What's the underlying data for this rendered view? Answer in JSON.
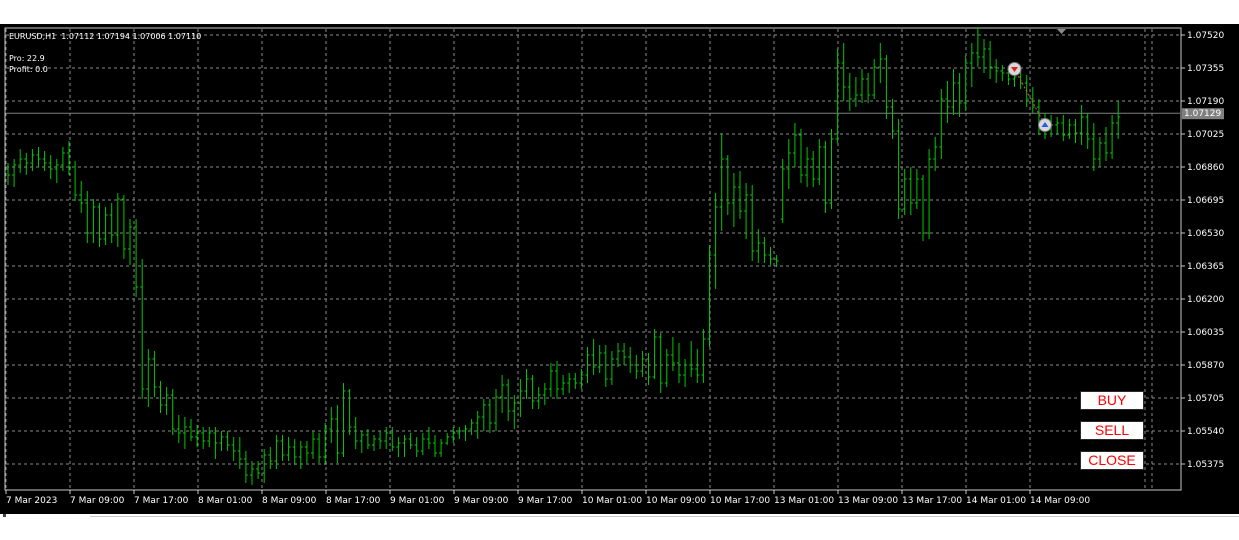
{
  "chart": {
    "symbol_line": "EURUSD,H1  1.07112 1.07194 1.07006 1.07110",
    "pro_label": "Pro: 22.9",
    "profit_label": "Profit: 0.0",
    "current_price": "1.07129",
    "price_ticks": [
      "1.07520",
      "1.07355",
      "1.07190",
      "1.07025",
      "1.06860",
      "1.06695",
      "1.06530",
      "1.06365",
      "1.06200",
      "1.06035",
      "1.05870",
      "1.05705",
      "1.05540",
      "1.05375"
    ],
    "time_ticks": [
      "7 Mar 2023",
      "7 Mar 09:00",
      "7 Mar 17:00",
      "8 Mar 01:00",
      "8 Mar 09:00",
      "8 Mar 17:00",
      "9 Mar 01:00",
      "9 Mar 09:00",
      "9 Mar 17:00",
      "10 Mar 01:00",
      "10 Mar 09:00",
      "10 Mar 17:00",
      "13 Mar 01:00",
      "13 Mar 09:00",
      "13 Mar 17:00",
      "14 Mar 01:00",
      "14 Mar 09:00"
    ],
    "colors": {
      "background": "#000000",
      "bars": "#00c800",
      "grid": "#8a8a8a",
      "text": "#ffffff",
      "price_label_bg": "#808080",
      "button_text": "#ff0000"
    },
    "icons": {
      "sell_marker": "sell-arrow-down-icon",
      "buy_marker": "buy-arrow-up-icon",
      "shift_marker": "chart-shift-triangle-icon"
    }
  },
  "buttons": {
    "buy": "BUY",
    "sell": "SELL",
    "close": "CLOSE"
  },
  "chart_data": {
    "type": "ohlc",
    "symbol": "EURUSD",
    "timeframe": "H1",
    "ylim": [
      1.053,
      1.076
    ],
    "grid": true,
    "bars": [
      {
        "o": 1.0685,
        "h": 1.0688,
        "l": 1.0677,
        "c": 1.0682
      },
      {
        "o": 1.0682,
        "h": 1.069,
        "l": 1.0676,
        "c": 1.0687
      },
      {
        "o": 1.0687,
        "h": 1.0695,
        "l": 1.0683,
        "c": 1.069
      },
      {
        "o": 1.069,
        "h": 1.0693,
        "l": 1.0682,
        "c": 1.0688
      },
      {
        "o": 1.0688,
        "h": 1.0695,
        "l": 1.0684,
        "c": 1.0692
      },
      {
        "o": 1.0692,
        "h": 1.0696,
        "l": 1.0686,
        "c": 1.069
      },
      {
        "o": 1.069,
        "h": 1.0694,
        "l": 1.0684,
        "c": 1.0688
      },
      {
        "o": 1.0688,
        "h": 1.0692,
        "l": 1.068,
        "c": 1.0685
      },
      {
        "o": 1.0685,
        "h": 1.069,
        "l": 1.0678,
        "c": 1.0687
      },
      {
        "o": 1.0687,
        "h": 1.0696,
        "l": 1.0684,
        "c": 1.0693
      },
      {
        "o": 1.0693,
        "h": 1.0699,
        "l": 1.0682,
        "c": 1.0686
      },
      {
        "o": 1.0686,
        "h": 1.0689,
        "l": 1.0669,
        "c": 1.0672
      },
      {
        "o": 1.0672,
        "h": 1.0679,
        "l": 1.0663,
        "c": 1.0668
      },
      {
        "o": 1.0668,
        "h": 1.0674,
        "l": 1.0648,
        "c": 1.0653
      },
      {
        "o": 1.0653,
        "h": 1.067,
        "l": 1.0648,
        "c": 1.0666
      },
      {
        "o": 1.0666,
        "h": 1.0668,
        "l": 1.0646,
        "c": 1.065
      },
      {
        "o": 1.065,
        "h": 1.0666,
        "l": 1.0647,
        "c": 1.0662
      },
      {
        "o": 1.0662,
        "h": 1.0668,
        "l": 1.0648,
        "c": 1.0652
      },
      {
        "o": 1.0652,
        "h": 1.0673,
        "l": 1.0646,
        "c": 1.067
      },
      {
        "o": 1.067,
        "h": 1.0672,
        "l": 1.064,
        "c": 1.0645
      },
      {
        "o": 1.0645,
        "h": 1.066,
        "l": 1.0637,
        "c": 1.0656
      },
      {
        "o": 1.0656,
        "h": 1.066,
        "l": 1.0621,
        "c": 1.0626
      },
      {
        "o": 1.0626,
        "h": 1.064,
        "l": 1.057,
        "c": 1.0575
      },
      {
        "o": 1.0575,
        "h": 1.0595,
        "l": 1.0566,
        "c": 1.059
      },
      {
        "o": 1.059,
        "h": 1.0594,
        "l": 1.0571,
        "c": 1.0576
      },
      {
        "o": 1.0576,
        "h": 1.0579,
        "l": 1.0563,
        "c": 1.0567
      },
      {
        "o": 1.0567,
        "h": 1.0576,
        "l": 1.0562,
        "c": 1.0572
      },
      {
        "o": 1.0572,
        "h": 1.0575,
        "l": 1.0552,
        "c": 1.0555
      },
      {
        "o": 1.0555,
        "h": 1.0562,
        "l": 1.0548,
        "c": 1.0553
      },
      {
        "o": 1.0553,
        "h": 1.0561,
        "l": 1.0545,
        "c": 1.0556
      },
      {
        "o": 1.0556,
        "h": 1.056,
        "l": 1.0549,
        "c": 1.0551
      },
      {
        "o": 1.0551,
        "h": 1.0557,
        "l": 1.0546,
        "c": 1.0553
      },
      {
        "o": 1.0553,
        "h": 1.0556,
        "l": 1.0545,
        "c": 1.0549
      },
      {
        "o": 1.0549,
        "h": 1.0556,
        "l": 1.0546,
        "c": 1.0553
      },
      {
        "o": 1.0553,
        "h": 1.0556,
        "l": 1.054,
        "c": 1.0548
      },
      {
        "o": 1.0548,
        "h": 1.0554,
        "l": 1.0544,
        "c": 1.0551
      },
      {
        "o": 1.0551,
        "h": 1.0554,
        "l": 1.0544,
        "c": 1.0547
      },
      {
        "o": 1.0547,
        "h": 1.0551,
        "l": 1.0539,
        "c": 1.0544
      },
      {
        "o": 1.0544,
        "h": 1.0551,
        "l": 1.0535,
        "c": 1.054
      },
      {
        "o": 1.054,
        "h": 1.0544,
        "l": 1.0528,
        "c": 1.0532
      },
      {
        "o": 1.0532,
        "h": 1.0539,
        "l": 1.0527,
        "c": 1.0535
      },
      {
        "o": 1.0535,
        "h": 1.0539,
        "l": 1.053,
        "c": 1.0533
      },
      {
        "o": 1.0533,
        "h": 1.0545,
        "l": 1.0528,
        "c": 1.0542
      },
      {
        "o": 1.0542,
        "h": 1.0546,
        "l": 1.0535,
        "c": 1.0539
      },
      {
        "o": 1.0539,
        "h": 1.0552,
        "l": 1.0535,
        "c": 1.0549
      },
      {
        "o": 1.0549,
        "h": 1.0552,
        "l": 1.0539,
        "c": 1.0542
      },
      {
        "o": 1.0542,
        "h": 1.0551,
        "l": 1.0539,
        "c": 1.0546
      },
      {
        "o": 1.0546,
        "h": 1.055,
        "l": 1.0537,
        "c": 1.0541
      },
      {
        "o": 1.0541,
        "h": 1.0549,
        "l": 1.0535,
        "c": 1.0546
      },
      {
        "o": 1.0546,
        "h": 1.0549,
        "l": 1.0538,
        "c": 1.0543
      },
      {
        "o": 1.0543,
        "h": 1.0554,
        "l": 1.054,
        "c": 1.055
      },
      {
        "o": 1.055,
        "h": 1.0553,
        "l": 1.0538,
        "c": 1.0541
      },
      {
        "o": 1.0541,
        "h": 1.0558,
        "l": 1.0537,
        "c": 1.0555
      },
      {
        "o": 1.0555,
        "h": 1.0566,
        "l": 1.0548,
        "c": 1.056
      },
      {
        "o": 1.056,
        "h": 1.0567,
        "l": 1.0538,
        "c": 1.0543
      },
      {
        "o": 1.0543,
        "h": 1.0578,
        "l": 1.0541,
        "c": 1.0574
      },
      {
        "o": 1.0574,
        "h": 1.0575,
        "l": 1.0552,
        "c": 1.0556
      },
      {
        "o": 1.0556,
        "h": 1.0561,
        "l": 1.0545,
        "c": 1.0549
      },
      {
        "o": 1.0549,
        "h": 1.0554,
        "l": 1.0543,
        "c": 1.0552
      },
      {
        "o": 1.0552,
        "h": 1.0555,
        "l": 1.0545,
        "c": 1.0547
      },
      {
        "o": 1.0547,
        "h": 1.0552,
        "l": 1.0544,
        "c": 1.055
      },
      {
        "o": 1.055,
        "h": 1.0554,
        "l": 1.0545,
        "c": 1.0549
      },
      {
        "o": 1.0549,
        "h": 1.0556,
        "l": 1.0545,
        "c": 1.0553
      },
      {
        "o": 1.0553,
        "h": 1.0556,
        "l": 1.0544,
        "c": 1.0546
      },
      {
        "o": 1.0546,
        "h": 1.0551,
        "l": 1.0541,
        "c": 1.0548
      },
      {
        "o": 1.0548,
        "h": 1.0552,
        "l": 1.0541,
        "c": 1.055
      },
      {
        "o": 1.055,
        "h": 1.0553,
        "l": 1.0545,
        "c": 1.0547
      },
      {
        "o": 1.0547,
        "h": 1.0551,
        "l": 1.0541,
        "c": 1.0544
      },
      {
        "o": 1.0544,
        "h": 1.0553,
        "l": 1.0542,
        "c": 1.055
      },
      {
        "o": 1.055,
        "h": 1.0556,
        "l": 1.0545,
        "c": 1.0548
      },
      {
        "o": 1.0548,
        "h": 1.0552,
        "l": 1.0541,
        "c": 1.0543
      },
      {
        "o": 1.0543,
        "h": 1.055,
        "l": 1.0541,
        "c": 1.0548
      },
      {
        "o": 1.0548,
        "h": 1.0553,
        "l": 1.0547,
        "c": 1.0551
      },
      {
        "o": 1.0551,
        "h": 1.0556,
        "l": 1.0548,
        "c": 1.0553
      },
      {
        "o": 1.0553,
        "h": 1.0556,
        "l": 1.055,
        "c": 1.0554
      },
      {
        "o": 1.0554,
        "h": 1.0557,
        "l": 1.0549,
        "c": 1.0555
      },
      {
        "o": 1.0555,
        "h": 1.056,
        "l": 1.0552,
        "c": 1.0558
      },
      {
        "o": 1.0558,
        "h": 1.0564,
        "l": 1.055,
        "c": 1.0561
      },
      {
        "o": 1.0561,
        "h": 1.057,
        "l": 1.0554,
        "c": 1.0567
      },
      {
        "o": 1.0567,
        "h": 1.057,
        "l": 1.0553,
        "c": 1.0558
      },
      {
        "o": 1.0558,
        "h": 1.0575,
        "l": 1.0554,
        "c": 1.0571
      },
      {
        "o": 1.0571,
        "h": 1.0582,
        "l": 1.0563,
        "c": 1.0577
      },
      {
        "o": 1.0577,
        "h": 1.058,
        "l": 1.0559,
        "c": 1.0564
      },
      {
        "o": 1.0564,
        "h": 1.0572,
        "l": 1.0555,
        "c": 1.0568
      },
      {
        "o": 1.0568,
        "h": 1.058,
        "l": 1.0561,
        "c": 1.0574
      },
      {
        "o": 1.0574,
        "h": 1.0585,
        "l": 1.057,
        "c": 1.058
      },
      {
        "o": 1.058,
        "h": 1.0582,
        "l": 1.0565,
        "c": 1.0569
      },
      {
        "o": 1.0569,
        "h": 1.0576,
        "l": 1.0565,
        "c": 1.0572
      },
      {
        "o": 1.0572,
        "h": 1.0578,
        "l": 1.0567,
        "c": 1.0575
      },
      {
        "o": 1.0575,
        "h": 1.0588,
        "l": 1.0571,
        "c": 1.0584
      },
      {
        "o": 1.0584,
        "h": 1.0589,
        "l": 1.057,
        "c": 1.0575
      },
      {
        "o": 1.0575,
        "h": 1.0582,
        "l": 1.0572,
        "c": 1.0578
      },
      {
        "o": 1.0578,
        "h": 1.0583,
        "l": 1.0573,
        "c": 1.058
      },
      {
        "o": 1.058,
        "h": 1.0583,
        "l": 1.0575,
        "c": 1.0578
      },
      {
        "o": 1.0578,
        "h": 1.0585,
        "l": 1.0575,
        "c": 1.0582
      },
      {
        "o": 1.0582,
        "h": 1.0596,
        "l": 1.0578,
        "c": 1.0592
      },
      {
        "o": 1.0592,
        "h": 1.06,
        "l": 1.0582,
        "c": 1.0586
      },
      {
        "o": 1.0586,
        "h": 1.0597,
        "l": 1.0583,
        "c": 1.0593
      },
      {
        "o": 1.0593,
        "h": 1.0597,
        "l": 1.0576,
        "c": 1.058
      },
      {
        "o": 1.058,
        "h": 1.0594,
        "l": 1.0577,
        "c": 1.059
      },
      {
        "o": 1.059,
        "h": 1.0598,
        "l": 1.0586,
        "c": 1.0594
      },
      {
        "o": 1.0594,
        "h": 1.0598,
        "l": 1.0587,
        "c": 1.0591
      },
      {
        "o": 1.0591,
        "h": 1.0596,
        "l": 1.0583,
        "c": 1.0587
      },
      {
        "o": 1.0587,
        "h": 1.0592,
        "l": 1.058,
        "c": 1.0584
      },
      {
        "o": 1.0584,
        "h": 1.0594,
        "l": 1.0581,
        "c": 1.059
      },
      {
        "o": 1.059,
        "h": 1.0593,
        "l": 1.0577,
        "c": 1.0581
      },
      {
        "o": 1.0581,
        "h": 1.0605,
        "l": 1.058,
        "c": 1.0601
      },
      {
        "o": 1.0601,
        "h": 1.0603,
        "l": 1.0573,
        "c": 1.0578
      },
      {
        "o": 1.0578,
        "h": 1.0595,
        "l": 1.0576,
        "c": 1.0592
      },
      {
        "o": 1.0592,
        "h": 1.0601,
        "l": 1.0584,
        "c": 1.0588
      },
      {
        "o": 1.0588,
        "h": 1.0598,
        "l": 1.0578,
        "c": 1.0582
      },
      {
        "o": 1.0582,
        "h": 1.059,
        "l": 1.0576,
        "c": 1.0587
      },
      {
        "o": 1.0587,
        "h": 1.0599,
        "l": 1.0581,
        "c": 1.0585
      },
      {
        "o": 1.0585,
        "h": 1.0595,
        "l": 1.0578,
        "c": 1.0582
      },
      {
        "o": 1.0582,
        "h": 1.0605,
        "l": 1.0578,
        "c": 1.06
      },
      {
        "o": 1.06,
        "h": 1.0647,
        "l": 1.0596,
        "c": 1.0642
      },
      {
        "o": 1.0642,
        "h": 1.0673,
        "l": 1.0625,
        "c": 1.0666
      },
      {
        "o": 1.0666,
        "h": 1.0703,
        "l": 1.0654,
        "c": 1.069
      },
      {
        "o": 1.069,
        "h": 1.0692,
        "l": 1.0662,
        "c": 1.0668
      },
      {
        "o": 1.0668,
        "h": 1.0683,
        "l": 1.0656,
        "c": 1.0676
      },
      {
        "o": 1.0676,
        "h": 1.0684,
        "l": 1.066,
        "c": 1.0664
      },
      {
        "o": 1.0664,
        "h": 1.0678,
        "l": 1.065,
        "c": 1.0672
      },
      {
        "o": 1.0672,
        "h": 1.0677,
        "l": 1.0639,
        "c": 1.0644
      },
      {
        "o": 1.0644,
        "h": 1.0655,
        "l": 1.0638,
        "c": 1.0648
      },
      {
        "o": 1.0648,
        "h": 1.0651,
        "l": 1.0638,
        "c": 1.0642
      },
      {
        "o": 1.0642,
        "h": 1.0646,
        "l": 1.0637,
        "c": 1.064
      },
      {
        "o": 1.064,
        "h": 1.0642,
        "l": 1.0636,
        "c": 1.0639
      },
      {
        "o": 1.066,
        "h": 1.069,
        "l": 1.0658,
        "c": 1.0685
      },
      {
        "o": 1.0685,
        "h": 1.07,
        "l": 1.0675,
        "c": 1.0693
      },
      {
        "o": 1.0693,
        "h": 1.0708,
        "l": 1.0686,
        "c": 1.0702
      },
      {
        "o": 1.0702,
        "h": 1.0705,
        "l": 1.0678,
        "c": 1.0682
      },
      {
        "o": 1.0682,
        "h": 1.0696,
        "l": 1.0676,
        "c": 1.069
      },
      {
        "o": 1.069,
        "h": 1.0694,
        "l": 1.0676,
        "c": 1.068
      },
      {
        "o": 1.068,
        "h": 1.07,
        "l": 1.0677,
        "c": 1.0696
      },
      {
        "o": 1.0696,
        "h": 1.0699,
        "l": 1.0663,
        "c": 1.0668
      },
      {
        "o": 1.0668,
        "h": 1.0705,
        "l": 1.0665,
        "c": 1.07
      },
      {
        "o": 1.07,
        "h": 1.0745,
        "l": 1.0698,
        "c": 1.0738
      },
      {
        "o": 1.0738,
        "h": 1.0748,
        "l": 1.0719,
        "c": 1.0726
      },
      {
        "o": 1.0726,
        "h": 1.0733,
        "l": 1.0714,
        "c": 1.072
      },
      {
        "o": 1.072,
        "h": 1.0731,
        "l": 1.0716,
        "c": 1.0722
      },
      {
        "o": 1.0722,
        "h": 1.0735,
        "l": 1.0718,
        "c": 1.073
      },
      {
        "o": 1.073,
        "h": 1.0733,
        "l": 1.0718,
        "c": 1.0722
      },
      {
        "o": 1.0722,
        "h": 1.074,
        "l": 1.072,
        "c": 1.0736
      },
      {
        "o": 1.0736,
        "h": 1.0748,
        "l": 1.0728,
        "c": 1.074
      },
      {
        "o": 1.074,
        "h": 1.0742,
        "l": 1.071,
        "c": 1.0716
      },
      {
        "o": 1.0716,
        "h": 1.072,
        "l": 1.07,
        "c": 1.0704
      },
      {
        "o": 1.0704,
        "h": 1.071,
        "l": 1.066,
        "c": 1.0665
      },
      {
        "o": 1.0665,
        "h": 1.0685,
        "l": 1.0662,
        "c": 1.068
      },
      {
        "o": 1.068,
        "h": 1.0686,
        "l": 1.0662,
        "c": 1.0668
      },
      {
        "o": 1.0668,
        "h": 1.0685,
        "l": 1.0665,
        "c": 1.068
      },
      {
        "o": 1.068,
        "h": 1.0682,
        "l": 1.0649,
        "c": 1.0653
      },
      {
        "o": 1.0653,
        "h": 1.0695,
        "l": 1.065,
        "c": 1.069
      },
      {
        "o": 1.069,
        "h": 1.0701,
        "l": 1.0684,
        "c": 1.0696
      },
      {
        "o": 1.0696,
        "h": 1.0725,
        "l": 1.069,
        "c": 1.072
      },
      {
        "o": 1.072,
        "h": 1.0729,
        "l": 1.0708,
        "c": 1.0716
      },
      {
        "o": 1.0716,
        "h": 1.0735,
        "l": 1.0712,
        "c": 1.0728
      },
      {
        "o": 1.0728,
        "h": 1.0733,
        "l": 1.0711,
        "c": 1.0718
      },
      {
        "o": 1.0718,
        "h": 1.0742,
        "l": 1.0714,
        "c": 1.0738
      },
      {
        "o": 1.0738,
        "h": 1.0748,
        "l": 1.0726,
        "c": 1.0743
      },
      {
        "o": 1.0743,
        "h": 1.0756,
        "l": 1.0736,
        "c": 1.0741
      },
      {
        "o": 1.0741,
        "h": 1.075,
        "l": 1.0733,
        "c": 1.0745
      },
      {
        "o": 1.0745,
        "h": 1.0749,
        "l": 1.073,
        "c": 1.0736
      },
      {
        "o": 1.0736,
        "h": 1.074,
        "l": 1.0728,
        "c": 1.0734
      },
      {
        "o": 1.0734,
        "h": 1.0737,
        "l": 1.0729,
        "c": 1.0733
      },
      {
        "o": 1.0733,
        "h": 1.0736,
        "l": 1.0727,
        "c": 1.073
      },
      {
        "o": 1.073,
        "h": 1.0734,
        "l": 1.0726,
        "c": 1.0731
      },
      {
        "o": 1.0731,
        "h": 1.0735,
        "l": 1.0725,
        "c": 1.0728
      },
      {
        "o": 1.0728,
        "h": 1.0732,
        "l": 1.0716,
        "c": 1.072
      },
      {
        "o": 1.072,
        "h": 1.0726,
        "l": 1.0713,
        "c": 1.0716
      },
      {
        "o": 1.0716,
        "h": 1.072,
        "l": 1.0702,
        "c": 1.0705
      },
      {
        "o": 1.0705,
        "h": 1.0713,
        "l": 1.07,
        "c": 1.0709
      },
      {
        "o": 1.0709,
        "h": 1.0712,
        "l": 1.0701,
        "c": 1.0707
      },
      {
        "o": 1.0707,
        "h": 1.0711,
        "l": 1.0702,
        "c": 1.0708
      },
      {
        "o": 1.0708,
        "h": 1.0712,
        "l": 1.0699,
        "c": 1.0702
      },
      {
        "o": 1.0702,
        "h": 1.071,
        "l": 1.07,
        "c": 1.0707
      },
      {
        "o": 1.0707,
        "h": 1.071,
        "l": 1.0698,
        "c": 1.0703
      },
      {
        "o": 1.0703,
        "h": 1.0717,
        "l": 1.0697,
        "c": 1.0711
      },
      {
        "o": 1.0711,
        "h": 1.0713,
        "l": 1.0695,
        "c": 1.07
      },
      {
        "o": 1.07,
        "h": 1.0708,
        "l": 1.0684,
        "c": 1.069
      },
      {
        "o": 1.069,
        "h": 1.0701,
        "l": 1.0686,
        "c": 1.0698
      },
      {
        "o": 1.0698,
        "h": 1.0706,
        "l": 1.0689,
        "c": 1.0693
      },
      {
        "o": 1.0693,
        "h": 1.0712,
        "l": 1.069,
        "c": 1.0708
      },
      {
        "o": 1.0708,
        "h": 1.0719,
        "l": 1.07,
        "c": 1.0711
      }
    ],
    "markers": [
      {
        "kind": "sell",
        "bar": 165,
        "price": 1.0735
      },
      {
        "kind": "buy",
        "bar": 170,
        "price": 1.0707
      }
    ],
    "current_price": 1.07129
  }
}
